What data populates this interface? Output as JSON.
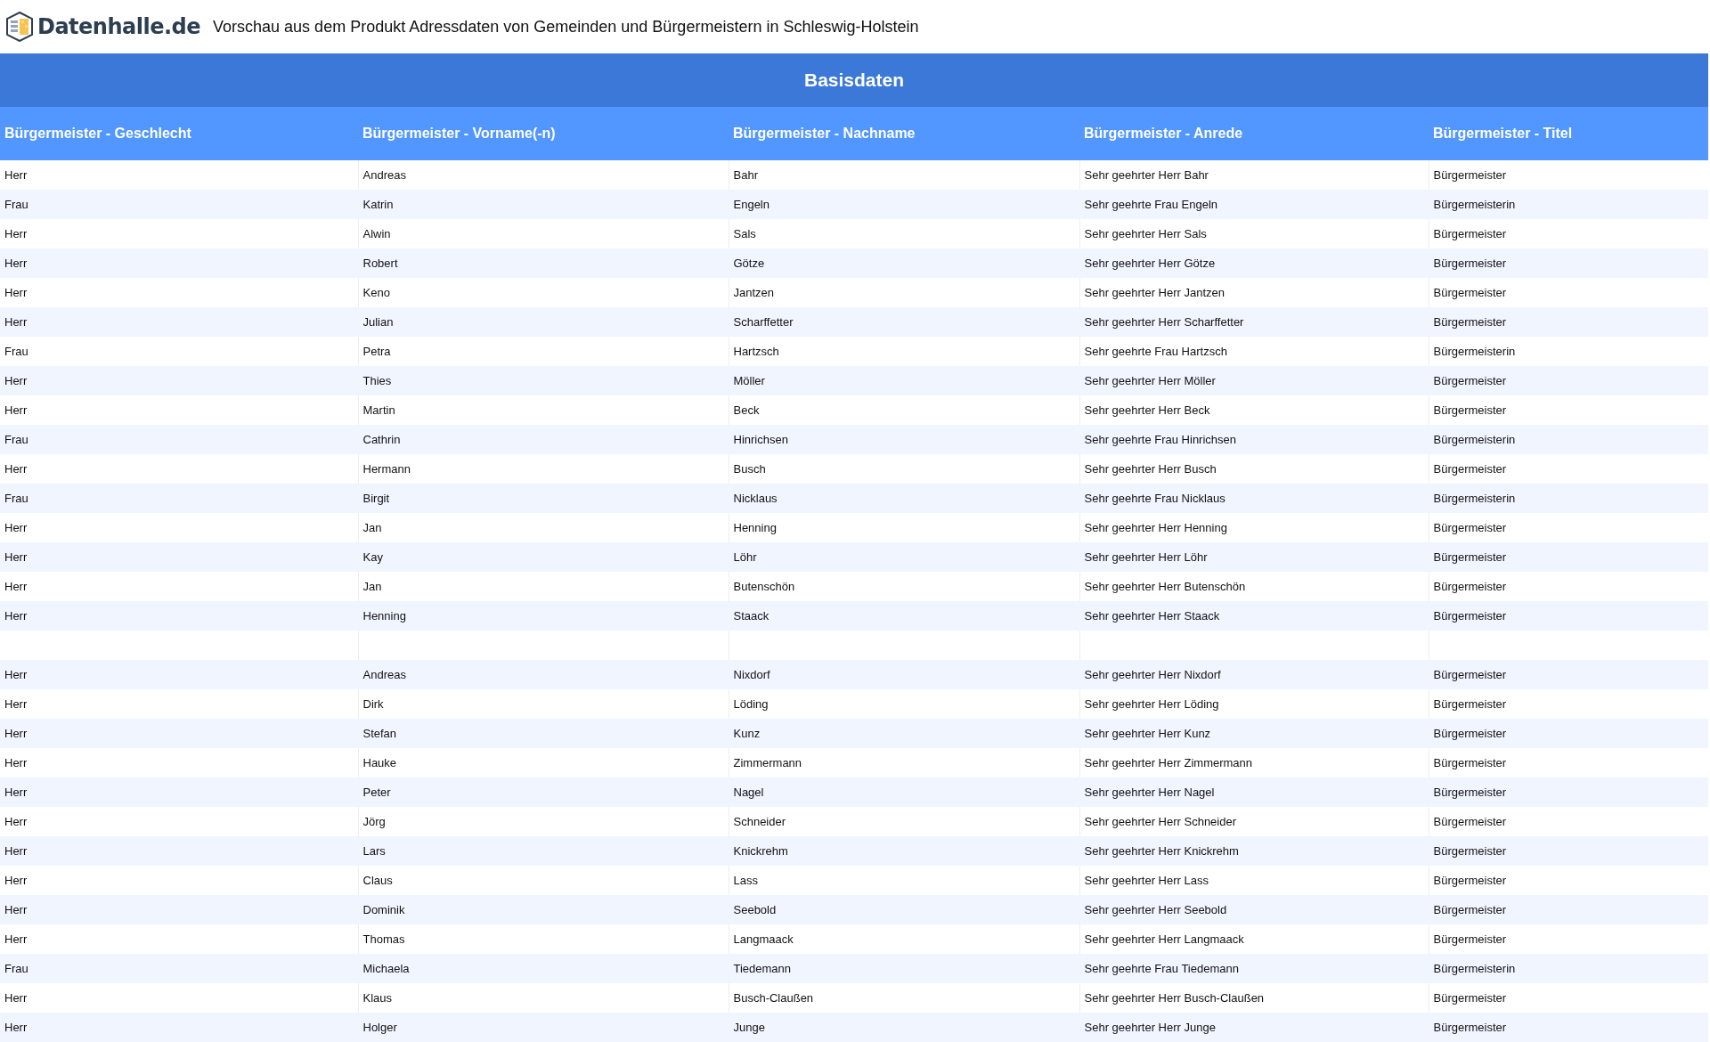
{
  "header": {
    "logo_text": "Datenhalle.de",
    "title": "Vorschau aus dem Produkt Adressdaten von Gemeinden und Bürgermeistern in Schleswig-Holstein"
  },
  "table": {
    "caption": "Basisdaten",
    "columns": [
      "Bürgermeister - Geschlecht",
      "Bürgermeister - Vorname(-n)",
      "Bürgermeister - Nachname",
      "Bürgermeister - Anrede",
      "Bürgermeister - Titel"
    ],
    "rows": [
      {
        "kind": "data",
        "cells": [
          "Herr",
          "Andreas",
          "Bahr",
          "Sehr geehrter Herr Bahr",
          "Bürgermeister"
        ]
      },
      {
        "kind": "data",
        "cells": [
          "Frau",
          "Katrin",
          "Engeln",
          "Sehr geehrte Frau Engeln",
          "Bürgermeisterin"
        ]
      },
      {
        "kind": "data",
        "cells": [
          "Herr",
          "Alwin",
          "Sals",
          "Sehr geehrter Herr Sals",
          "Bürgermeister"
        ]
      },
      {
        "kind": "data",
        "cells": [
          "Herr",
          "Robert",
          "Götze",
          "Sehr geehrter Herr Götze",
          "Bürgermeister"
        ]
      },
      {
        "kind": "data",
        "cells": [
          "Herr",
          "Keno",
          "Jantzen",
          "Sehr geehrter Herr Jantzen",
          "Bürgermeister"
        ]
      },
      {
        "kind": "data",
        "cells": [
          "Herr",
          "Julian",
          "Scharffetter",
          "Sehr geehrter Herr Scharffetter",
          "Bürgermeister"
        ]
      },
      {
        "kind": "data",
        "cells": [
          "Frau",
          "Petra",
          "Hartzsch",
          "Sehr geehrte Frau Hartzsch",
          "Bürgermeisterin"
        ]
      },
      {
        "kind": "data",
        "cells": [
          "Herr",
          "Thies",
          "Möller",
          "Sehr geehrter Herr Möller",
          "Bürgermeister"
        ]
      },
      {
        "kind": "data",
        "cells": [
          "Herr",
          "Martin",
          "Beck",
          "Sehr geehrter Herr Beck",
          "Bürgermeister"
        ]
      },
      {
        "kind": "data",
        "cells": [
          "Frau",
          "Cathrin",
          "Hinrichsen",
          "Sehr geehrte Frau Hinrichsen",
          "Bürgermeisterin"
        ]
      },
      {
        "kind": "data",
        "cells": [
          "Herr",
          "Hermann",
          "Busch",
          "Sehr geehrter Herr Busch",
          "Bürgermeister"
        ]
      },
      {
        "kind": "data",
        "cells": [
          "Frau",
          "Birgit",
          "Nicklaus",
          "Sehr geehrte Frau Nicklaus",
          "Bürgermeisterin"
        ]
      },
      {
        "kind": "data",
        "cells": [
          "Herr",
          "Jan",
          "Henning",
          "Sehr geehrter Herr Henning",
          "Bürgermeister"
        ]
      },
      {
        "kind": "data",
        "cells": [
          "Herr",
          "Kay",
          "Löhr",
          "Sehr geehrter Herr Löhr",
          "Bürgermeister"
        ]
      },
      {
        "kind": "data",
        "cells": [
          "Herr",
          "Jan",
          "Butenschön",
          "Sehr geehrter Herr Butenschön",
          "Bürgermeister"
        ]
      },
      {
        "kind": "data",
        "cells": [
          "Herr",
          "Henning",
          "Staack",
          "Sehr geehrter Herr Staack",
          "Bürgermeister"
        ]
      },
      {
        "kind": "blank"
      },
      {
        "kind": "data",
        "cells": [
          "Herr",
          "Andreas",
          "Nixdorf",
          "Sehr geehrter Herr Nixdorf",
          "Bürgermeister"
        ]
      },
      {
        "kind": "data",
        "cells": [
          "Herr",
          "Dirk",
          "Löding",
          "Sehr geehrter Herr Löding",
          "Bürgermeister"
        ]
      },
      {
        "kind": "data",
        "cells": [
          "Herr",
          "Stefan",
          "Kunz",
          "Sehr geehrter Herr Kunz",
          "Bürgermeister"
        ]
      },
      {
        "kind": "data",
        "cells": [
          "Herr",
          "Hauke",
          "Zimmermann",
          "Sehr geehrter Herr Zimmermann",
          "Bürgermeister"
        ]
      },
      {
        "kind": "data",
        "cells": [
          "Herr",
          "Peter",
          "Nagel",
          "Sehr geehrter Herr Nagel",
          "Bürgermeister"
        ]
      },
      {
        "kind": "data",
        "cells": [
          "Herr",
          "Jörg",
          "Schneider",
          "Sehr geehrter Herr Schneider",
          "Bürgermeister"
        ]
      },
      {
        "kind": "data",
        "cells": [
          "Herr",
          "Lars",
          "Knickrehm",
          "Sehr geehrter Herr Knickrehm",
          "Bürgermeister"
        ]
      },
      {
        "kind": "data",
        "cells": [
          "Herr",
          "Claus",
          "Lass",
          "Sehr geehrter Herr Lass",
          "Bürgermeister"
        ]
      },
      {
        "kind": "data",
        "cells": [
          "Herr",
          "Dominik",
          "Seebold",
          "Sehr geehrter Herr Seebold",
          "Bürgermeister"
        ]
      },
      {
        "kind": "data",
        "cells": [
          "Herr",
          "Thomas",
          "Langmaack",
          "Sehr geehrter Herr Langmaack",
          "Bürgermeister"
        ]
      },
      {
        "kind": "data",
        "cells": [
          "Frau",
          "Michaela",
          "Tiedemann",
          "Sehr geehrte Frau Tiedemann",
          "Bürgermeisterin"
        ]
      },
      {
        "kind": "data",
        "cells": [
          "Herr",
          "Klaus",
          "Busch-Claußen",
          "Sehr geehrter Herr Busch-Claußen",
          "Bürgermeister"
        ]
      },
      {
        "kind": "data",
        "cells": [
          "Herr",
          "Holger",
          "Junge",
          "Sehr geehrter Herr Junge",
          "Bürgermeister"
        ]
      }
    ]
  }
}
